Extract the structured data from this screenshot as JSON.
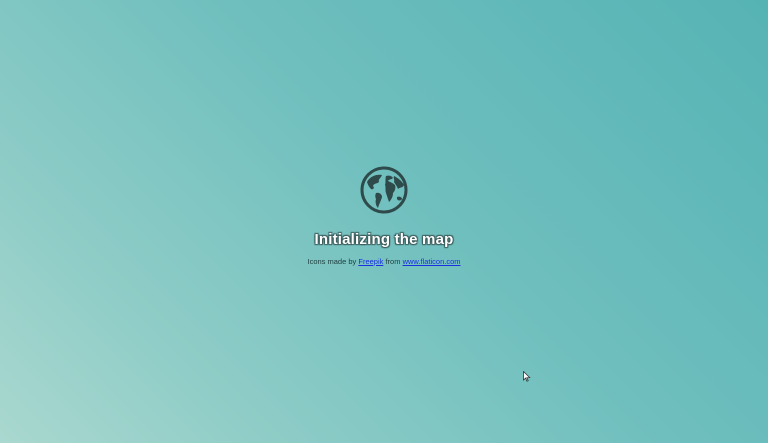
{
  "loading": {
    "globe_icon": "globe-icon",
    "title": "Initializing the map"
  },
  "credit": {
    "prefix": "Icons made by",
    "author_link": "Freepik",
    "middle": "from",
    "site_link": "www.flaticon.com"
  },
  "colors": {
    "background_start": "#56b3b4",
    "background_end": "#a9d8cf",
    "globe": "#2f4a4a",
    "link": "#1b2fe0"
  },
  "cursor_icon": "mouse-pointer-icon"
}
